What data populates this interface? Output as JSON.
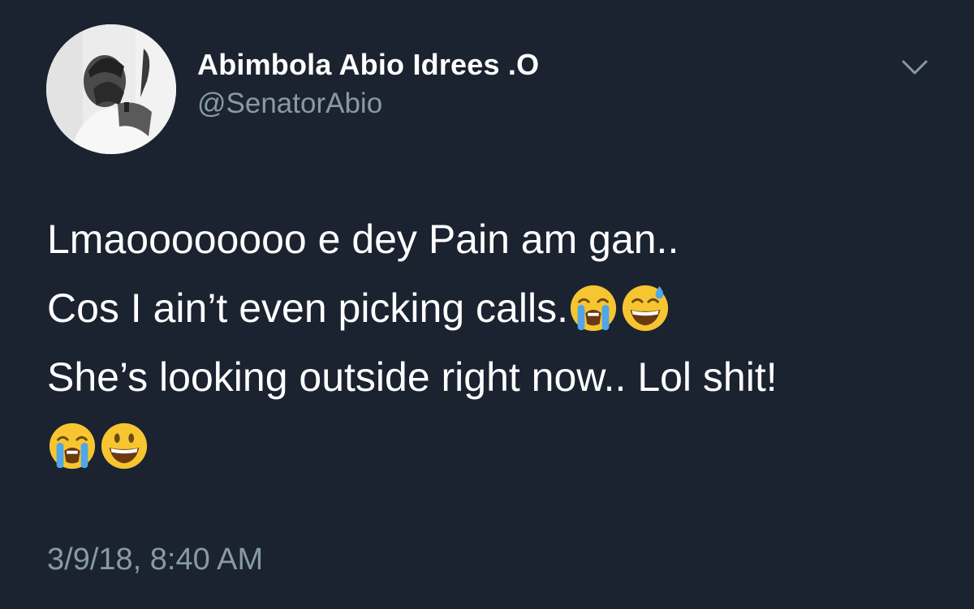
{
  "user": {
    "display_name": "Abimbola Abio Idrees .O",
    "handle": "@SenatorAbio"
  },
  "tweet": {
    "line1": "Lmaoooooooo e dey Pain am gan..",
    "line2": "Cos I ain’t even picking calls.",
    "line2_emojis": [
      "loudly-crying-face",
      "grinning-face-with-sweat"
    ],
    "line3": "She’s looking outside right now.. Lol shit!",
    "line4_emojis": [
      "loudly-crying-face",
      "grinning-face"
    ]
  },
  "timestamp": "3/9/18, 8:40 AM",
  "colors": {
    "background": "#1b2330",
    "text": "#ffffff",
    "secondary_text": "#8899a6"
  },
  "icons": {
    "menu": "chevron-down-icon"
  }
}
